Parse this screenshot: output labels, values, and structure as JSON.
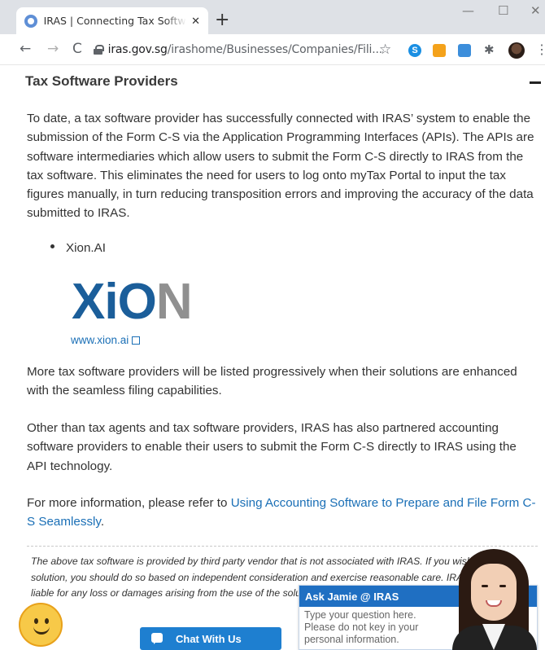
{
  "browser": {
    "tab_title": "IRAS | Connecting Tax Software P",
    "tab_close": "✕",
    "new_tab": "+",
    "minimize": "—",
    "maximize": "☐",
    "close_window": "✕",
    "back": "←",
    "forward": "→",
    "reload": "C",
    "url_domain": "iras.gov.sg",
    "url_path": "/irashome/Businesses/Companies/Fili...",
    "bookmark": "☆",
    "extensions": [
      "S",
      "",
      "",
      "✱"
    ],
    "menu": "⋮"
  },
  "page": {
    "section_title": "Tax Software Providers",
    "intro": "To date, a tax software provider has successfully connected with IRAS’ system to enable the submission of the Form C-S via the Application Programming Interfaces (APIs). The APIs are software intermediaries which allow users to submit the Form C-S directly to IRAS from the tax software. This eliminates the need for users to log onto myTax Portal to input the tax figures manually, in turn reducing transposition errors and improving the accuracy of the data submitted to IRAS.",
    "providers": [
      "Xion.AI"
    ],
    "logo_text_blue": "XiO",
    "logo_text_grey": "N",
    "logo_link": "www.xion.ai",
    "more_providers": "More tax software providers will be listed progressively when their solutions are enhanced with the seamless filing capabilities.",
    "partners": "Other than tax agents and tax software providers, IRAS has also partnered accounting software providers to enable their users to submit the Form C-S directly to IRAS using the API technology.",
    "more_info_prefix": "For more information, please refer to ",
    "more_info_link": "Using Accounting Software to Prepare and File Form C-S Seamlessly",
    "more_info_suffix": ".",
    "disclaimer": "The above tax software is provided by third party vendor that is not associated with IRAS. If you wish to use the solution, you should do so based on independent consideration and exercise reasonable care. IRAS shall not be liable for any loss or damages arising from the use of the solution."
  },
  "chat": {
    "button_label": "Chat With Us",
    "ask_title": "Ask Jamie @ IRAS",
    "ask_placeholder": "Type your question here. Please do not key in your personal information."
  }
}
